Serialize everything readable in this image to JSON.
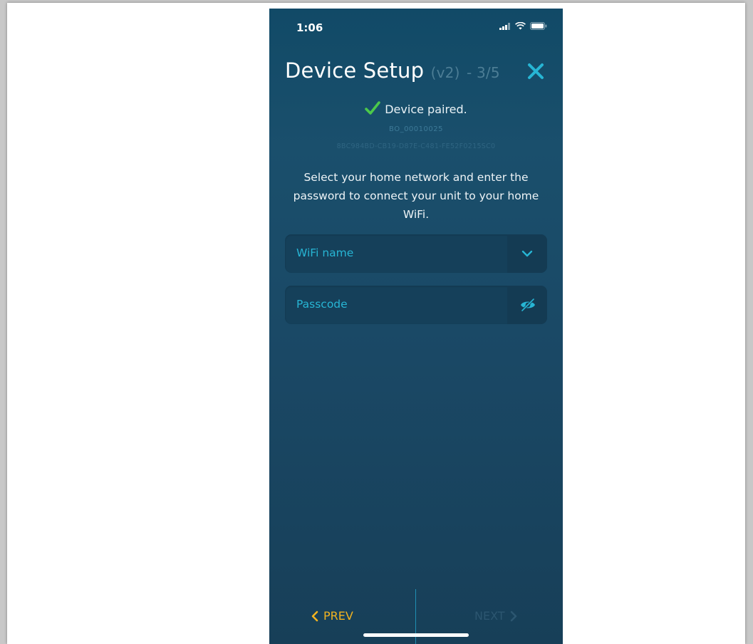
{
  "status_bar": {
    "time": "1:06"
  },
  "header": {
    "title": "Device Setup",
    "version": "(v2)",
    "step": "- 3/5"
  },
  "pairing": {
    "status": "Device paired.",
    "device_id": "BO_00010025",
    "device_uuid": "8BC984BD-CB19-D87E-C481-FE52F0215SC0"
  },
  "instructions": "Select your home network and enter the password to connect your unit to your home WiFi.",
  "form": {
    "wifi_label": "WiFi name",
    "passcode_label": "Passcode"
  },
  "footer": {
    "prev_label": "PREV",
    "next_label": "NEXT"
  },
  "icons": {
    "close": "close-icon",
    "check": "checkmark-icon",
    "dropdown": "chevron-down-icon",
    "visibility": "eye-slash-icon",
    "prev": "chevron-left-icon",
    "next": "chevron-right-icon"
  },
  "colors": {
    "background_top": "#114a67",
    "background_bottom": "#173f58",
    "accent_cyan": "#27b5d4",
    "accent_yellow": "#f2b320",
    "success_green": "#4cc94a"
  }
}
